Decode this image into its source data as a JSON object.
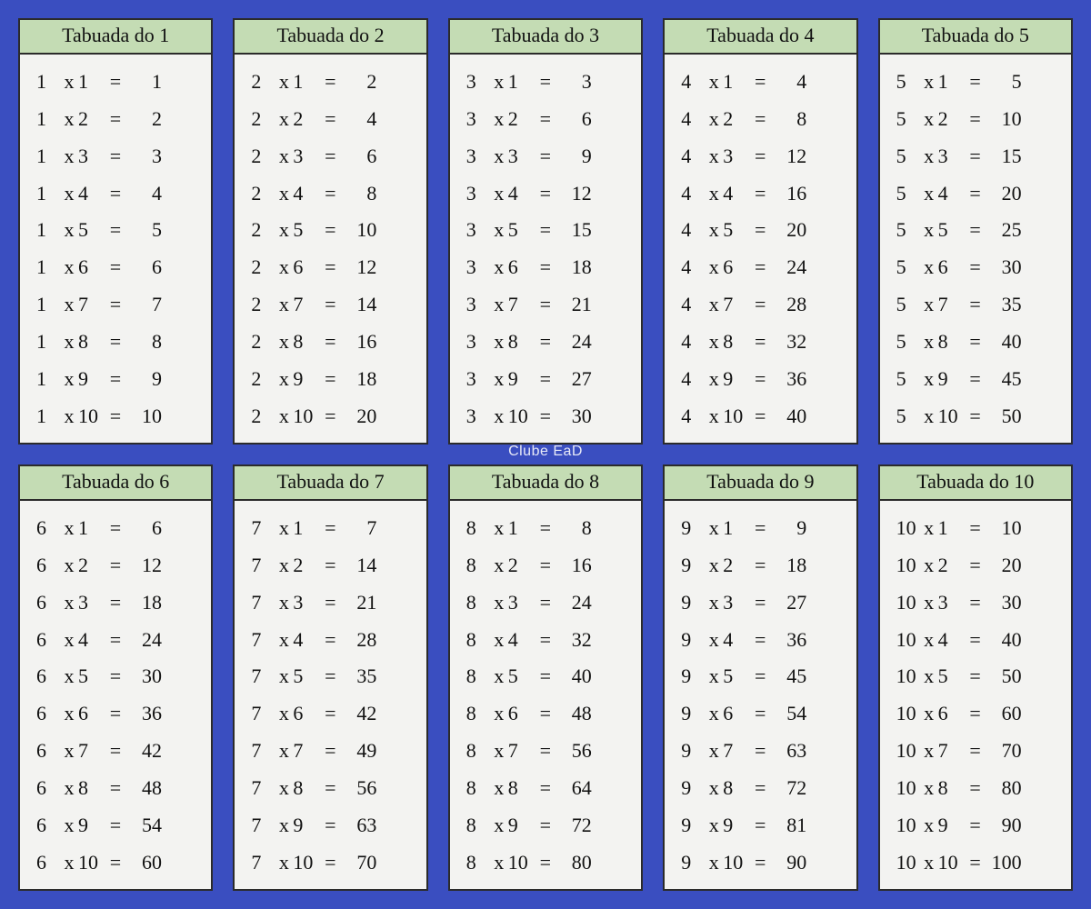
{
  "watermark": "Clube EaD",
  "title_prefix": "Tabuada do ",
  "symbols": {
    "times": "x",
    "equals": "="
  },
  "tables": [
    {
      "n": 1,
      "title": "Tabuada do 1",
      "rows": [
        [
          1,
          1,
          1
        ],
        [
          1,
          2,
          2
        ],
        [
          1,
          3,
          3
        ],
        [
          1,
          4,
          4
        ],
        [
          1,
          5,
          5
        ],
        [
          1,
          6,
          6
        ],
        [
          1,
          7,
          7
        ],
        [
          1,
          8,
          8
        ],
        [
          1,
          9,
          9
        ],
        [
          1,
          10,
          10
        ]
      ]
    },
    {
      "n": 2,
      "title": "Tabuada do 2",
      "rows": [
        [
          2,
          1,
          2
        ],
        [
          2,
          2,
          4
        ],
        [
          2,
          3,
          6
        ],
        [
          2,
          4,
          8
        ],
        [
          2,
          5,
          10
        ],
        [
          2,
          6,
          12
        ],
        [
          2,
          7,
          14
        ],
        [
          2,
          8,
          16
        ],
        [
          2,
          9,
          18
        ],
        [
          2,
          10,
          20
        ]
      ]
    },
    {
      "n": 3,
      "title": "Tabuada do 3",
      "rows": [
        [
          3,
          1,
          3
        ],
        [
          3,
          2,
          6
        ],
        [
          3,
          3,
          9
        ],
        [
          3,
          4,
          12
        ],
        [
          3,
          5,
          15
        ],
        [
          3,
          6,
          18
        ],
        [
          3,
          7,
          21
        ],
        [
          3,
          8,
          24
        ],
        [
          3,
          9,
          27
        ],
        [
          3,
          10,
          30
        ]
      ]
    },
    {
      "n": 4,
      "title": "Tabuada do 4",
      "rows": [
        [
          4,
          1,
          4
        ],
        [
          4,
          2,
          8
        ],
        [
          4,
          3,
          12
        ],
        [
          4,
          4,
          16
        ],
        [
          4,
          5,
          20
        ],
        [
          4,
          6,
          24
        ],
        [
          4,
          7,
          28
        ],
        [
          4,
          8,
          32
        ],
        [
          4,
          9,
          36
        ],
        [
          4,
          10,
          40
        ]
      ]
    },
    {
      "n": 5,
      "title": "Tabuada do 5",
      "rows": [
        [
          5,
          1,
          5
        ],
        [
          5,
          2,
          10
        ],
        [
          5,
          3,
          15
        ],
        [
          5,
          4,
          20
        ],
        [
          5,
          5,
          25
        ],
        [
          5,
          6,
          30
        ],
        [
          5,
          7,
          35
        ],
        [
          5,
          8,
          40
        ],
        [
          5,
          9,
          45
        ],
        [
          5,
          10,
          50
        ]
      ]
    },
    {
      "n": 6,
      "title": "Tabuada do 6",
      "rows": [
        [
          6,
          1,
          6
        ],
        [
          6,
          2,
          12
        ],
        [
          6,
          3,
          18
        ],
        [
          6,
          4,
          24
        ],
        [
          6,
          5,
          30
        ],
        [
          6,
          6,
          36
        ],
        [
          6,
          7,
          42
        ],
        [
          6,
          8,
          48
        ],
        [
          6,
          9,
          54
        ],
        [
          6,
          10,
          60
        ]
      ]
    },
    {
      "n": 7,
      "title": "Tabuada do 7",
      "rows": [
        [
          7,
          1,
          7
        ],
        [
          7,
          2,
          14
        ],
        [
          7,
          3,
          21
        ],
        [
          7,
          4,
          28
        ],
        [
          7,
          5,
          35
        ],
        [
          7,
          6,
          42
        ],
        [
          7,
          7,
          49
        ],
        [
          7,
          8,
          56
        ],
        [
          7,
          9,
          63
        ],
        [
          7,
          10,
          70
        ]
      ]
    },
    {
      "n": 8,
      "title": "Tabuada do 8",
      "rows": [
        [
          8,
          1,
          8
        ],
        [
          8,
          2,
          16
        ],
        [
          8,
          3,
          24
        ],
        [
          8,
          4,
          32
        ],
        [
          8,
          5,
          40
        ],
        [
          8,
          6,
          48
        ],
        [
          8,
          7,
          56
        ],
        [
          8,
          8,
          64
        ],
        [
          8,
          9,
          72
        ],
        [
          8,
          10,
          80
        ]
      ]
    },
    {
      "n": 9,
      "title": "Tabuada do 9",
      "rows": [
        [
          9,
          1,
          9
        ],
        [
          9,
          2,
          18
        ],
        [
          9,
          3,
          27
        ],
        [
          9,
          4,
          36
        ],
        [
          9,
          5,
          45
        ],
        [
          9,
          6,
          54
        ],
        [
          9,
          7,
          63
        ],
        [
          9,
          8,
          72
        ],
        [
          9,
          9,
          81
        ],
        [
          9,
          10,
          90
        ]
      ]
    },
    {
      "n": 10,
      "title": "Tabuada do 10",
      "rows": [
        [
          10,
          1,
          10
        ],
        [
          10,
          2,
          20
        ],
        [
          10,
          3,
          30
        ],
        [
          10,
          4,
          40
        ],
        [
          10,
          5,
          50
        ],
        [
          10,
          6,
          60
        ],
        [
          10,
          7,
          70
        ],
        [
          10,
          8,
          80
        ],
        [
          10,
          9,
          90
        ],
        [
          10,
          10,
          100
        ]
      ]
    }
  ]
}
